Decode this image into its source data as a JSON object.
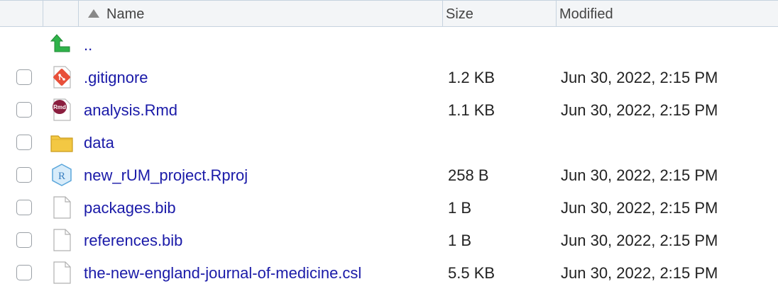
{
  "header": {
    "name_label": "Name",
    "size_label": "Size",
    "modified_label": "Modified"
  },
  "parent": {
    "label": ".."
  },
  "files": [
    {
      "name": ".gitignore",
      "icon": "git-file-icon",
      "size": "1.2 KB",
      "modified": "Jun 30, 2022, 2:15 PM"
    },
    {
      "name": "analysis.Rmd",
      "icon": "rmd-file-icon",
      "size": "1.1 KB",
      "modified": "Jun 30, 2022, 2:15 PM"
    },
    {
      "name": "data",
      "icon": "folder-icon",
      "size": "",
      "modified": ""
    },
    {
      "name": "new_rUM_project.Rproj",
      "icon": "rproj-file-icon",
      "size": "258 B",
      "modified": "Jun 30, 2022, 2:15 PM"
    },
    {
      "name": "packages.bib",
      "icon": "blank-file-icon",
      "size": "1 B",
      "modified": "Jun 30, 2022, 2:15 PM"
    },
    {
      "name": "references.bib",
      "icon": "blank-file-icon",
      "size": "1 B",
      "modified": "Jun 30, 2022, 2:15 PM"
    },
    {
      "name": "the-new-england-journal-of-medicine.csl",
      "icon": "blank-file-icon",
      "size": "5.5 KB",
      "modified": "Jun 30, 2022, 2:15 PM"
    }
  ]
}
